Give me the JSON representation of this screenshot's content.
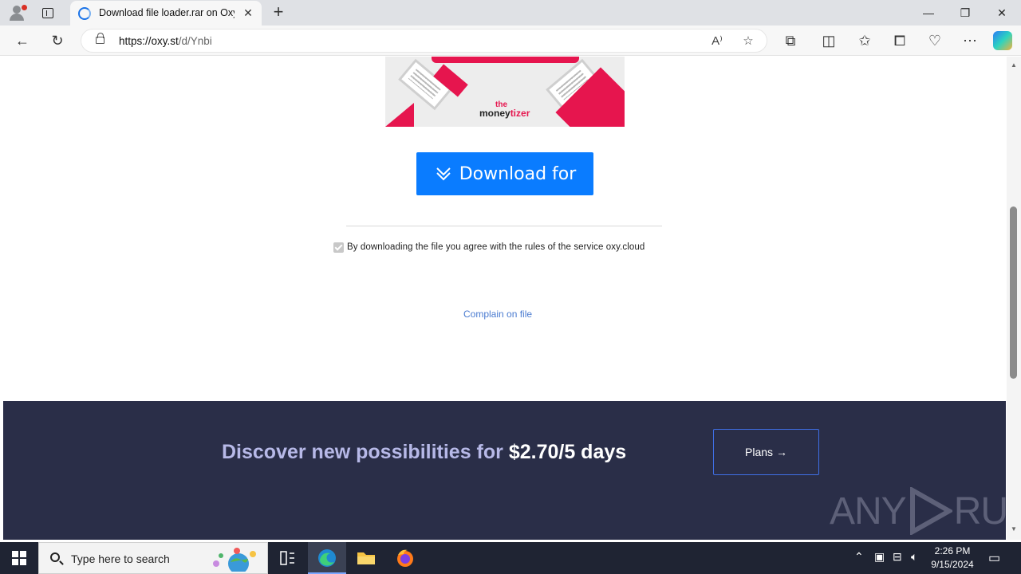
{
  "browser": {
    "tab_title": "Download file loader.rar on Oxy.Cloud",
    "url_host": "https://oxy.st",
    "url_path": "/d/Ynbi"
  },
  "ad": {
    "logo_top": "the",
    "logo_money": "money",
    "logo_tizer": "tizer"
  },
  "page": {
    "download_label": "Download for",
    "agree_text": "By downloading the file you agree with the rules of the service oxy.cloud",
    "agree_checked": true,
    "complain_label": "Complain on file"
  },
  "promo": {
    "headline_text": "Discover new possibilities for ",
    "headline_price": "$2.70/5 days",
    "plans_label": "Plans →",
    "watermark_left": "ANY",
    "watermark_right": "RUN"
  },
  "taskbar": {
    "search_placeholder": "Type here to search",
    "time": "2:26 PM",
    "date": "9/15/2024"
  },
  "colors": {
    "download_button": "#0a7cff",
    "promo_bg": "#2a2e48",
    "promo_text": "#b7b9e8",
    "ad_accent": "#e6154e",
    "link": "#4a7bd0"
  }
}
